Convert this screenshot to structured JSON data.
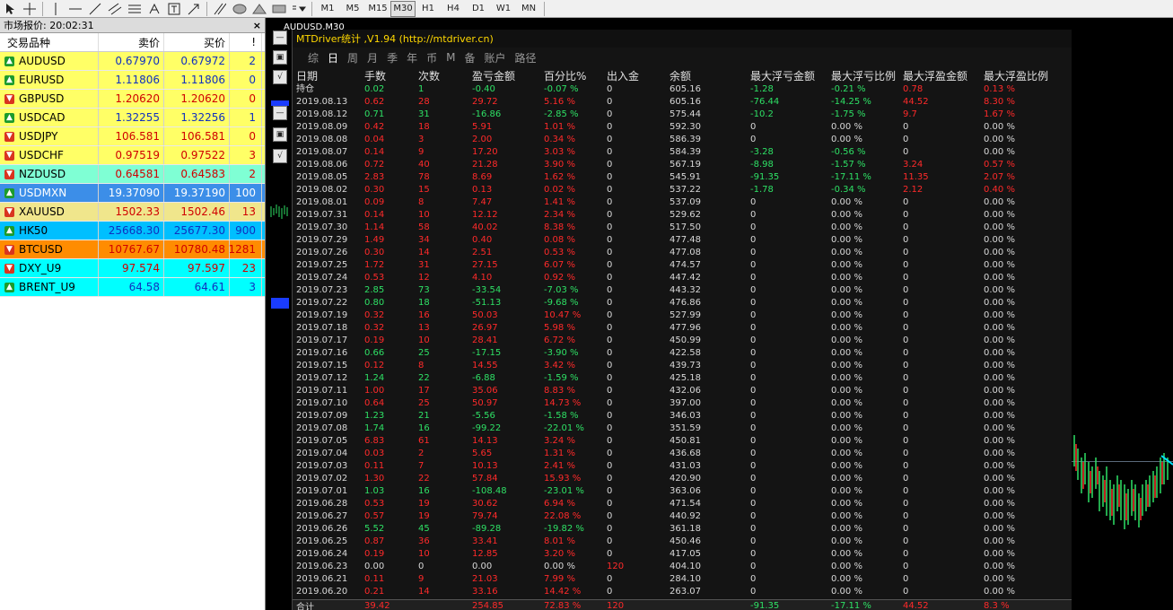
{
  "toolbar": {
    "timeframes": [
      "M1",
      "M5",
      "M15",
      "M30",
      "H1",
      "H4",
      "D1",
      "W1",
      "MN"
    ],
    "active_timeframe": "M30"
  },
  "market_watch": {
    "title": "市场报价: 20:02:31",
    "close": "×",
    "headers": {
      "symbol": "交易品种",
      "bid": "卖价",
      "ask": "买价",
      "spread": "!"
    },
    "rows": [
      {
        "symbol": "AUDUSD",
        "bid": "0.67970",
        "ask": "0.67972",
        "spread": "2",
        "dir": "up",
        "bg": "#ffff66",
        "color": "#1030c0"
      },
      {
        "symbol": "EURUSD",
        "bid": "1.11806",
        "ask": "1.11806",
        "spread": "0",
        "dir": "up",
        "bg": "#ffff66",
        "color": "#1030c0"
      },
      {
        "symbol": "GBPUSD",
        "bid": "1.20620",
        "ask": "1.20620",
        "spread": "0",
        "dir": "down",
        "bg": "#ffff66",
        "color": "#d00000"
      },
      {
        "symbol": "USDCAD",
        "bid": "1.32255",
        "ask": "1.32256",
        "spread": "1",
        "dir": "up",
        "bg": "#ffff66",
        "color": "#1030c0"
      },
      {
        "symbol": "USDJPY",
        "bid": "106.581",
        "ask": "106.581",
        "spread": "0",
        "dir": "down",
        "bg": "#ffff66",
        "color": "#d00000"
      },
      {
        "symbol": "USDCHF",
        "bid": "0.97519",
        "ask": "0.97522",
        "spread": "3",
        "dir": "down",
        "bg": "#ffff66",
        "color": "#d00000"
      },
      {
        "symbol": "NZDUSD",
        "bid": "0.64581",
        "ask": "0.64583",
        "spread": "2",
        "dir": "down",
        "bg": "#7fffd4",
        "color": "#d00000"
      },
      {
        "symbol": "USDMXN",
        "bid": "19.37090",
        "ask": "19.37190",
        "spread": "100",
        "dir": "up",
        "bg": "#3c8ee8",
        "color": "#ffffff"
      },
      {
        "symbol": "XAUUSD",
        "bid": "1502.33",
        "ask": "1502.46",
        "spread": "13",
        "dir": "down",
        "bg": "#f0e68c",
        "color": "#d00000"
      },
      {
        "symbol": "HK50",
        "bid": "25668.30",
        "ask": "25677.30",
        "spread": "900",
        "dir": "up",
        "bg": "#00bfff",
        "color": "#1030c0"
      },
      {
        "symbol": "BTCUSD",
        "bid": "10767.67",
        "ask": "10780.48",
        "spread": "1281",
        "dir": "down",
        "bg": "#ff8c00",
        "color": "#d00000"
      },
      {
        "symbol": "DXY_U9",
        "bid": "97.574",
        "ask": "97.597",
        "spread": "23",
        "dir": "down",
        "bg": "#00ffff",
        "color": "#d00000"
      },
      {
        "symbol": "BRENT_U9",
        "bid": "64.58",
        "ask": "64.61",
        "spread": "3",
        "dir": "up",
        "bg": "#00ffff",
        "color": "#1030c0"
      }
    ]
  },
  "chart": {
    "title": "AUDUSD,M30"
  },
  "stats": {
    "title": "MTDriver统计 ,V1.94 (http://mtdriver.cn)",
    "tabs": [
      "综",
      "日",
      "周",
      "月",
      "季",
      "年",
      "币",
      "M",
      "备",
      "账户",
      "路径"
    ],
    "selected_tab": "日",
    "headers": [
      "日期",
      "手数",
      "次数",
      "盈亏金额",
      "百分比%",
      "出入金",
      "余额",
      "最大浮亏金额",
      "最大浮亏比例",
      "最大浮盈金额",
      "最大浮盈比例"
    ],
    "rows": [
      {
        "d": "持仓",
        "lot": "0.02",
        "n": "1",
        "pl": "-0.40",
        "pct": "-0.07 %",
        "io": "0",
        "bal": "605.16",
        "mfl": "-1.28",
        "mfr": "-0.21 %",
        "mpa": "0.78",
        "mpr": "0.13 %",
        "c": "g"
      },
      {
        "d": "2019.08.13",
        "lot": "0.62",
        "n": "28",
        "pl": "29.72",
        "pct": "5.16 %",
        "io": "0",
        "bal": "605.16",
        "mfl": "-76.44",
        "mfr": "-14.25 %",
        "mpa": "44.52",
        "mpr": "8.30 %",
        "c": "r"
      },
      {
        "d": "2019.08.12",
        "lot": "0.71",
        "n": "31",
        "pl": "-16.86",
        "pct": "-2.85 %",
        "io": "0",
        "bal": "575.44",
        "mfl": "-10.2",
        "mfr": "-1.75 %",
        "mpa": "9.7",
        "mpr": "1.67 %",
        "c": "g"
      },
      {
        "d": "2019.08.09",
        "lot": "0.42",
        "n": "18",
        "pl": "5.91",
        "pct": "1.01 %",
        "io": "0",
        "bal": "592.30",
        "mfl": "0",
        "mfr": "0.00 %",
        "mpa": "0",
        "mpr": "0.00 %",
        "c": "r"
      },
      {
        "d": "2019.08.08",
        "lot": "0.04",
        "n": "3",
        "pl": "2.00",
        "pct": "0.34 %",
        "io": "0",
        "bal": "586.39",
        "mfl": "0",
        "mfr": "0.00 %",
        "mpa": "0",
        "mpr": "0.00 %",
        "c": "r"
      },
      {
        "d": "2019.08.07",
        "lot": "0.14",
        "n": "9",
        "pl": "17.20",
        "pct": "3.03 %",
        "io": "0",
        "bal": "584.39",
        "mfl": "-3.28",
        "mfr": "-0.56 %",
        "mpa": "0",
        "mpr": "0.00 %",
        "c": "r"
      },
      {
        "d": "2019.08.06",
        "lot": "0.72",
        "n": "40",
        "pl": "21.28",
        "pct": "3.90 %",
        "io": "0",
        "bal": "567.19",
        "mfl": "-8.98",
        "mfr": "-1.57 %",
        "mpa": "3.24",
        "mpr": "0.57 %",
        "c": "r"
      },
      {
        "d": "2019.08.05",
        "lot": "2.83",
        "n": "78",
        "pl": "8.69",
        "pct": "1.62 %",
        "io": "0",
        "bal": "545.91",
        "mfl": "-91.35",
        "mfr": "-17.11 %",
        "mpa": "11.35",
        "mpr": "2.07 %",
        "c": "r"
      },
      {
        "d": "2019.08.02",
        "lot": "0.30",
        "n": "15",
        "pl": "0.13",
        "pct": "0.02 %",
        "io": "0",
        "bal": "537.22",
        "mfl": "-1.78",
        "mfr": "-0.34 %",
        "mpa": "2.12",
        "mpr": "0.40 %",
        "c": "r"
      },
      {
        "d": "2019.08.01",
        "lot": "0.09",
        "n": "8",
        "pl": "7.47",
        "pct": "1.41 %",
        "io": "0",
        "bal": "537.09",
        "mfl": "0",
        "mfr": "0.00 %",
        "mpa": "0",
        "mpr": "0.00 %",
        "c": "r"
      },
      {
        "d": "2019.07.31",
        "lot": "0.14",
        "n": "10",
        "pl": "12.12",
        "pct": "2.34 %",
        "io": "0",
        "bal": "529.62",
        "mfl": "0",
        "mfr": "0.00 %",
        "mpa": "0",
        "mpr": "0.00 %",
        "c": "r"
      },
      {
        "d": "2019.07.30",
        "lot": "1.14",
        "n": "58",
        "pl": "40.02",
        "pct": "8.38 %",
        "io": "0",
        "bal": "517.50",
        "mfl": "0",
        "mfr": "0.00 %",
        "mpa": "0",
        "mpr": "0.00 %",
        "c": "r"
      },
      {
        "d": "2019.07.29",
        "lot": "1.49",
        "n": "34",
        "pl": "0.40",
        "pct": "0.08 %",
        "io": "0",
        "bal": "477.48",
        "mfl": "0",
        "mfr": "0.00 %",
        "mpa": "0",
        "mpr": "0.00 %",
        "c": "r"
      },
      {
        "d": "2019.07.26",
        "lot": "0.30",
        "n": "14",
        "pl": "2.51",
        "pct": "0.53 %",
        "io": "0",
        "bal": "477.08",
        "mfl": "0",
        "mfr": "0.00 %",
        "mpa": "0",
        "mpr": "0.00 %",
        "c": "r"
      },
      {
        "d": "2019.07.25",
        "lot": "1.72",
        "n": "31",
        "pl": "27.15",
        "pct": "6.07 %",
        "io": "0",
        "bal": "474.57",
        "mfl": "0",
        "mfr": "0.00 %",
        "mpa": "0",
        "mpr": "0.00 %",
        "c": "r"
      },
      {
        "d": "2019.07.24",
        "lot": "0.53",
        "n": "12",
        "pl": "4.10",
        "pct": "0.92 %",
        "io": "0",
        "bal": "447.42",
        "mfl": "0",
        "mfr": "0.00 %",
        "mpa": "0",
        "mpr": "0.00 %",
        "c": "r"
      },
      {
        "d": "2019.07.23",
        "lot": "2.85",
        "n": "73",
        "pl": "-33.54",
        "pct": "-7.03 %",
        "io": "0",
        "bal": "443.32",
        "mfl": "0",
        "mfr": "0.00 %",
        "mpa": "0",
        "mpr": "0.00 %",
        "c": "g"
      },
      {
        "d": "2019.07.22",
        "lot": "0.80",
        "n": "18",
        "pl": "-51.13",
        "pct": "-9.68 %",
        "io": "0",
        "bal": "476.86",
        "mfl": "0",
        "mfr": "0.00 %",
        "mpa": "0",
        "mpr": "0.00 %",
        "c": "g"
      },
      {
        "d": "2019.07.19",
        "lot": "0.32",
        "n": "16",
        "pl": "50.03",
        "pct": "10.47 %",
        "io": "0",
        "bal": "527.99",
        "mfl": "0",
        "mfr": "0.00 %",
        "mpa": "0",
        "mpr": "0.00 %",
        "c": "r"
      },
      {
        "d": "2019.07.18",
        "lot": "0.32",
        "n": "13",
        "pl": "26.97",
        "pct": "5.98 %",
        "io": "0",
        "bal": "477.96",
        "mfl": "0",
        "mfr": "0.00 %",
        "mpa": "0",
        "mpr": "0.00 %",
        "c": "r"
      },
      {
        "d": "2019.07.17",
        "lot": "0.19",
        "n": "10",
        "pl": "28.41",
        "pct": "6.72 %",
        "io": "0",
        "bal": "450.99",
        "mfl": "0",
        "mfr": "0.00 %",
        "mpa": "0",
        "mpr": "0.00 %",
        "c": "r"
      },
      {
        "d": "2019.07.16",
        "lot": "0.66",
        "n": "25",
        "pl": "-17.15",
        "pct": "-3.90 %",
        "io": "0",
        "bal": "422.58",
        "mfl": "0",
        "mfr": "0.00 %",
        "mpa": "0",
        "mpr": "0.00 %",
        "c": "g"
      },
      {
        "d": "2019.07.15",
        "lot": "0.12",
        "n": "8",
        "pl": "14.55",
        "pct": "3.42 %",
        "io": "0",
        "bal": "439.73",
        "mfl": "0",
        "mfr": "0.00 %",
        "mpa": "0",
        "mpr": "0.00 %",
        "c": "r"
      },
      {
        "d": "2019.07.12",
        "lot": "1.24",
        "n": "22",
        "pl": "-6.88",
        "pct": "-1.59 %",
        "io": "0",
        "bal": "425.18",
        "mfl": "0",
        "mfr": "0.00 %",
        "mpa": "0",
        "mpr": "0.00 %",
        "c": "g"
      },
      {
        "d": "2019.07.11",
        "lot": "1.00",
        "n": "17",
        "pl": "35.06",
        "pct": "8.83 %",
        "io": "0",
        "bal": "432.06",
        "mfl": "0",
        "mfr": "0.00 %",
        "mpa": "0",
        "mpr": "0.00 %",
        "c": "r"
      },
      {
        "d": "2019.07.10",
        "lot": "0.64",
        "n": "25",
        "pl": "50.97",
        "pct": "14.73 %",
        "io": "0",
        "bal": "397.00",
        "mfl": "0",
        "mfr": "0.00 %",
        "mpa": "0",
        "mpr": "0.00 %",
        "c": "r"
      },
      {
        "d": "2019.07.09",
        "lot": "1.23",
        "n": "21",
        "pl": "-5.56",
        "pct": "-1.58 %",
        "io": "0",
        "bal": "346.03",
        "mfl": "0",
        "mfr": "0.00 %",
        "mpa": "0",
        "mpr": "0.00 %",
        "c": "g"
      },
      {
        "d": "2019.07.08",
        "lot": "1.74",
        "n": "16",
        "pl": "-99.22",
        "pct": "-22.01 %",
        "io": "0",
        "bal": "351.59",
        "mfl": "0",
        "mfr": "0.00 %",
        "mpa": "0",
        "mpr": "0.00 %",
        "c": "g"
      },
      {
        "d": "2019.07.05",
        "lot": "6.83",
        "n": "61",
        "pl": "14.13",
        "pct": "3.24 %",
        "io": "0",
        "bal": "450.81",
        "mfl": "0",
        "mfr": "0.00 %",
        "mpa": "0",
        "mpr": "0.00 %",
        "c": "r"
      },
      {
        "d": "2019.07.04",
        "lot": "0.03",
        "n": "2",
        "pl": "5.65",
        "pct": "1.31 %",
        "io": "0",
        "bal": "436.68",
        "mfl": "0",
        "mfr": "0.00 %",
        "mpa": "0",
        "mpr": "0.00 %",
        "c": "r"
      },
      {
        "d": "2019.07.03",
        "lot": "0.11",
        "n": "7",
        "pl": "10.13",
        "pct": "2.41 %",
        "io": "0",
        "bal": "431.03",
        "mfl": "0",
        "mfr": "0.00 %",
        "mpa": "0",
        "mpr": "0.00 %",
        "c": "r"
      },
      {
        "d": "2019.07.02",
        "lot": "1.30",
        "n": "22",
        "pl": "57.84",
        "pct": "15.93 %",
        "io": "0",
        "bal": "420.90",
        "mfl": "0",
        "mfr": "0.00 %",
        "mpa": "0",
        "mpr": "0.00 %",
        "c": "r"
      },
      {
        "d": "2019.07.01",
        "lot": "1.03",
        "n": "16",
        "pl": "-108.48",
        "pct": "-23.01 %",
        "io": "0",
        "bal": "363.06",
        "mfl": "0",
        "mfr": "0.00 %",
        "mpa": "0",
        "mpr": "0.00 %",
        "c": "g"
      },
      {
        "d": "2019.06.28",
        "lot": "0.53",
        "n": "19",
        "pl": "30.62",
        "pct": "6.94 %",
        "io": "0",
        "bal": "471.54",
        "mfl": "0",
        "mfr": "0.00 %",
        "mpa": "0",
        "mpr": "0.00 %",
        "c": "r"
      },
      {
        "d": "2019.06.27",
        "lot": "0.57",
        "n": "19",
        "pl": "79.74",
        "pct": "22.08 %",
        "io": "0",
        "bal": "440.92",
        "mfl": "0",
        "mfr": "0.00 %",
        "mpa": "0",
        "mpr": "0.00 %",
        "c": "r"
      },
      {
        "d": "2019.06.26",
        "lot": "5.52",
        "n": "45",
        "pl": "-89.28",
        "pct": "-19.82 %",
        "io": "0",
        "bal": "361.18",
        "mfl": "0",
        "mfr": "0.00 %",
        "mpa": "0",
        "mpr": "0.00 %",
        "c": "g"
      },
      {
        "d": "2019.06.25",
        "lot": "0.87",
        "n": "36",
        "pl": "33.41",
        "pct": "8.01 %",
        "io": "0",
        "bal": "450.46",
        "mfl": "0",
        "mfr": "0.00 %",
        "mpa": "0",
        "mpr": "0.00 %",
        "c": "r"
      },
      {
        "d": "2019.06.24",
        "lot": "0.19",
        "n": "10",
        "pl": "12.85",
        "pct": "3.20 %",
        "io": "0",
        "bal": "417.05",
        "mfl": "0",
        "mfr": "0.00 %",
        "mpa": "0",
        "mpr": "0.00 %",
        "c": "r"
      },
      {
        "d": "2019.06.23",
        "lot": "0.00",
        "n": "0",
        "pl": "0.00",
        "pct": "0.00 %",
        "io": "120",
        "bal": "404.10",
        "mfl": "0",
        "mfr": "0.00 %",
        "mpa": "0",
        "mpr": "0.00 %",
        "c": "w"
      },
      {
        "d": "2019.06.21",
        "lot": "0.11",
        "n": "9",
        "pl": "21.03",
        "pct": "7.99 %",
        "io": "0",
        "bal": "284.10",
        "mfl": "0",
        "mfr": "0.00 %",
        "mpa": "0",
        "mpr": "0.00 %",
        "c": "r"
      },
      {
        "d": "2019.06.20",
        "lot": "0.21",
        "n": "14",
        "pl": "33.16",
        "pct": "14.42 %",
        "io": "0",
        "bal": "263.07",
        "mfl": "0",
        "mfr": "0.00 %",
        "mpa": "0",
        "mpr": "0.00 %",
        "c": "r"
      }
    ],
    "total": {
      "d": "合计",
      "lot": "39.42",
      "n": "",
      "pl": "254.85",
      "pct": "72.83 %",
      "io": "120",
      "bal": "",
      "mfl": "-91.35",
      "mfr": "-17.11 %",
      "mpa": "44.52",
      "mpr": "8.3 %"
    }
  }
}
